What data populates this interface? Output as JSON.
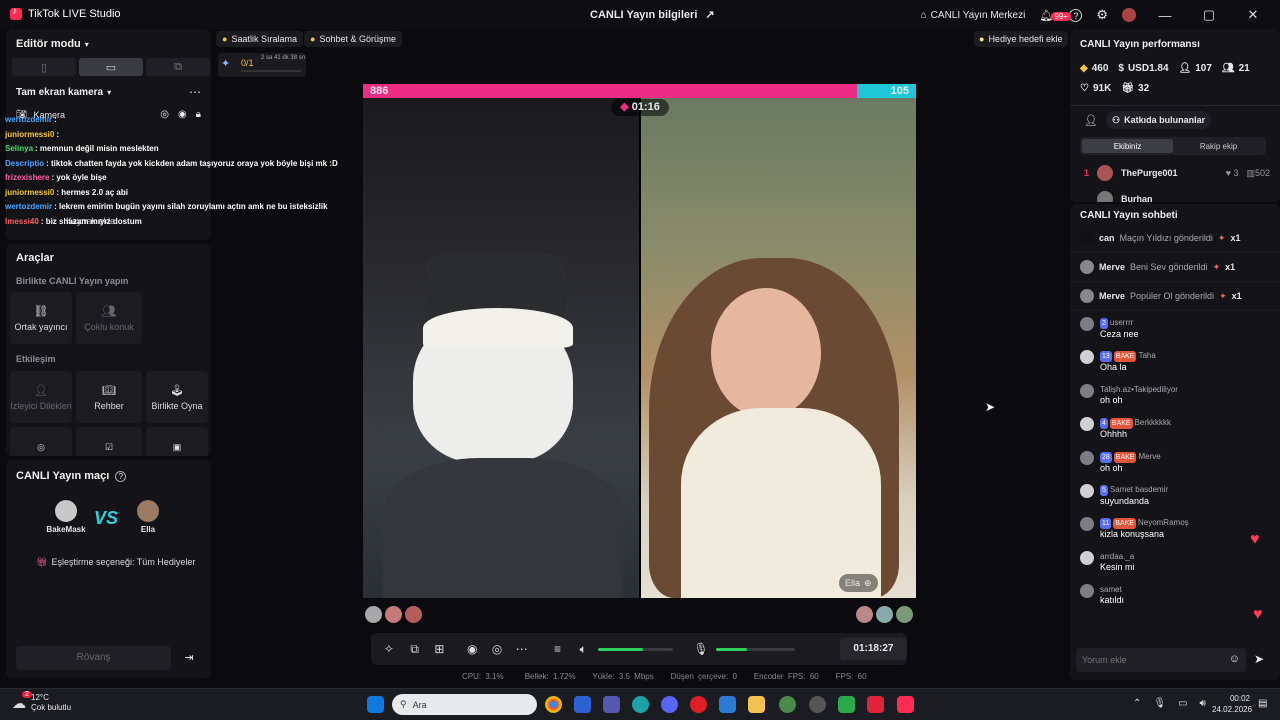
{
  "titlebar": {
    "app_name": "TikTok LIVE Studio",
    "center_title": "CANLI Yayın bilgileri",
    "live_center": "CANLI Yayın Merkezi",
    "notif_count": "99+"
  },
  "left": {
    "editor_mode": "Editör modu",
    "fullscreen_camera": "Tam ekran kamera",
    "camera_label": "Kamera",
    "add_source": "Kaynak ekle",
    "chat_overlay": [
      {
        "user": "wertozdemir",
        "text": ":",
        "color": "#4aa3ff"
      },
      {
        "user": "juniormessi0",
        "text": ":",
        "color": "#f4c542"
      },
      {
        "user": "Selinya",
        "text": ": memnun değil misin meslekten",
        "color": "#4cd964"
      },
      {
        "user": "Descriptio",
        "text": ": tiktok chatten fayda yok kickden adam taşıyoruz oraya yok böyle bişi mk :D",
        "color": "#4aa3ff"
      },
      {
        "user": "frizexishere",
        "text": ": yok öyle bişe",
        "color": "#ff5fa8"
      },
      {
        "user": "juniormessi0",
        "text": ": hermes 2.0 aç abi",
        "color": "#f4c542"
      },
      {
        "user": "wertozdemir",
        "text": ": lekrem emirim bugün yayını silah zoruylamı açtın amk ne bu isteksizlik",
        "color": "#4aa3ff"
      },
      {
        "user": "lmessi40",
        "text": ": biz shazam mıyız dostum",
        "color": "#ff5f5f"
      }
    ],
    "tools_title": "Araçlar",
    "collab_title": "Birlikte CANLI Yayın yapın",
    "tool_cohost": "Ortak yayıncı",
    "tool_multiguest": "Çoklu konuk",
    "interaction_title": "Etkileşim",
    "tool_viewer_requests": "İzleyici Dilekleri",
    "tool_guide": "Rehber",
    "tool_play_together": "Birlikte Oyna",
    "match_title": "CANLI Yayın maçı",
    "player1": "BakeMask",
    "player2": "Ella",
    "vs": "VS",
    "match_option": "Eşleştirme seçeneği: Tüm Hediyeler",
    "rematch": "Rövanş"
  },
  "top_chips": {
    "hourly_rank": "Saatlik Sıralama",
    "chat_meet": "Sohbet & Görüşme",
    "goal_progress": "0/1",
    "goal_time": "2 sa 41 dk 38 sn",
    "add_gift_goal": "Hediye hedefi ekle"
  },
  "battle": {
    "score_left": "886",
    "score_right": "105",
    "left_share": 0.894,
    "timer": "01:16",
    "right_name": "Ella"
  },
  "controls": {
    "volume_level": 0.6,
    "mic_level": 0.4,
    "elapsed": "01:18:27"
  },
  "stats": {
    "cpu": "CPU: 3.1%",
    "memory": "Bellek: 1.72%",
    "upload": "Yükle: 3.5 Mbps",
    "dropped": "Düşen çerçeve: 0",
    "encoder_fps": "Encoder FPS: 60",
    "fps": "FPS: 60"
  },
  "right": {
    "perf_title": "CANLI Yayın performansı",
    "coins": "460",
    "usd": "USD1.84",
    "followers": "107",
    "viewers_new": "21",
    "likes": "91K",
    "gifters": "32",
    "contributors": "Katkıda bulunanlar",
    "tab_ours": "Ekibiniz",
    "tab_rival": "Rakip ekip",
    "top_rank": "1",
    "top_user": "ThePurge001",
    "top_hearts": "3",
    "top_score": "502",
    "second_user": "Burhan",
    "chat_title": "CANLI Yayın sohbeti",
    "gifts": [
      {
        "user": "can",
        "text": "Maçın Yıldızı gönderildi",
        "count": "x1"
      },
      {
        "user": "Merve",
        "text": "Beni Sev gönderildi",
        "count": "x1"
      },
      {
        "user": "Merve",
        "text": "Popüler Ol gönderildi",
        "count": "x1"
      }
    ],
    "messages": [
      {
        "level": "2",
        "fan": "",
        "name": "userrrr",
        "text": "Ceza nee"
      },
      {
        "level": "13",
        "fan": "BAKE",
        "name": "Taha",
        "text": "Oha la"
      },
      {
        "level": "",
        "fan": "",
        "name": "Talişh.az•Takipediliyor",
        "text": "oh oh"
      },
      {
        "level": "4",
        "fan": "BAKE",
        "name": "Berkkkkkk",
        "text": "Ohhhh"
      },
      {
        "level": "28",
        "fan": "BAKE",
        "name": "Merve",
        "text": "oh oh"
      },
      {
        "level": "5",
        "fan": "",
        "name": "Samet basdemir",
        "text": "suyundanda"
      },
      {
        "level": "11",
        "fan": "BAKE",
        "name": "NeyomRamoş",
        "text": "kizla konuşsana"
      },
      {
        "level": "",
        "fan": "",
        "name": "arrdaa._a",
        "text": "Kesin mi"
      },
      {
        "level": "",
        "fan": "",
        "name": "samet",
        "text": "katıldı"
      }
    ],
    "comment_placeholder": "Yorum ekle"
  },
  "taskbar": {
    "temp": "12°C",
    "weather": "Çok bulutlu",
    "weather_badge": "2",
    "search": "Ara",
    "time": "00:02",
    "date": "24.02.2026"
  }
}
